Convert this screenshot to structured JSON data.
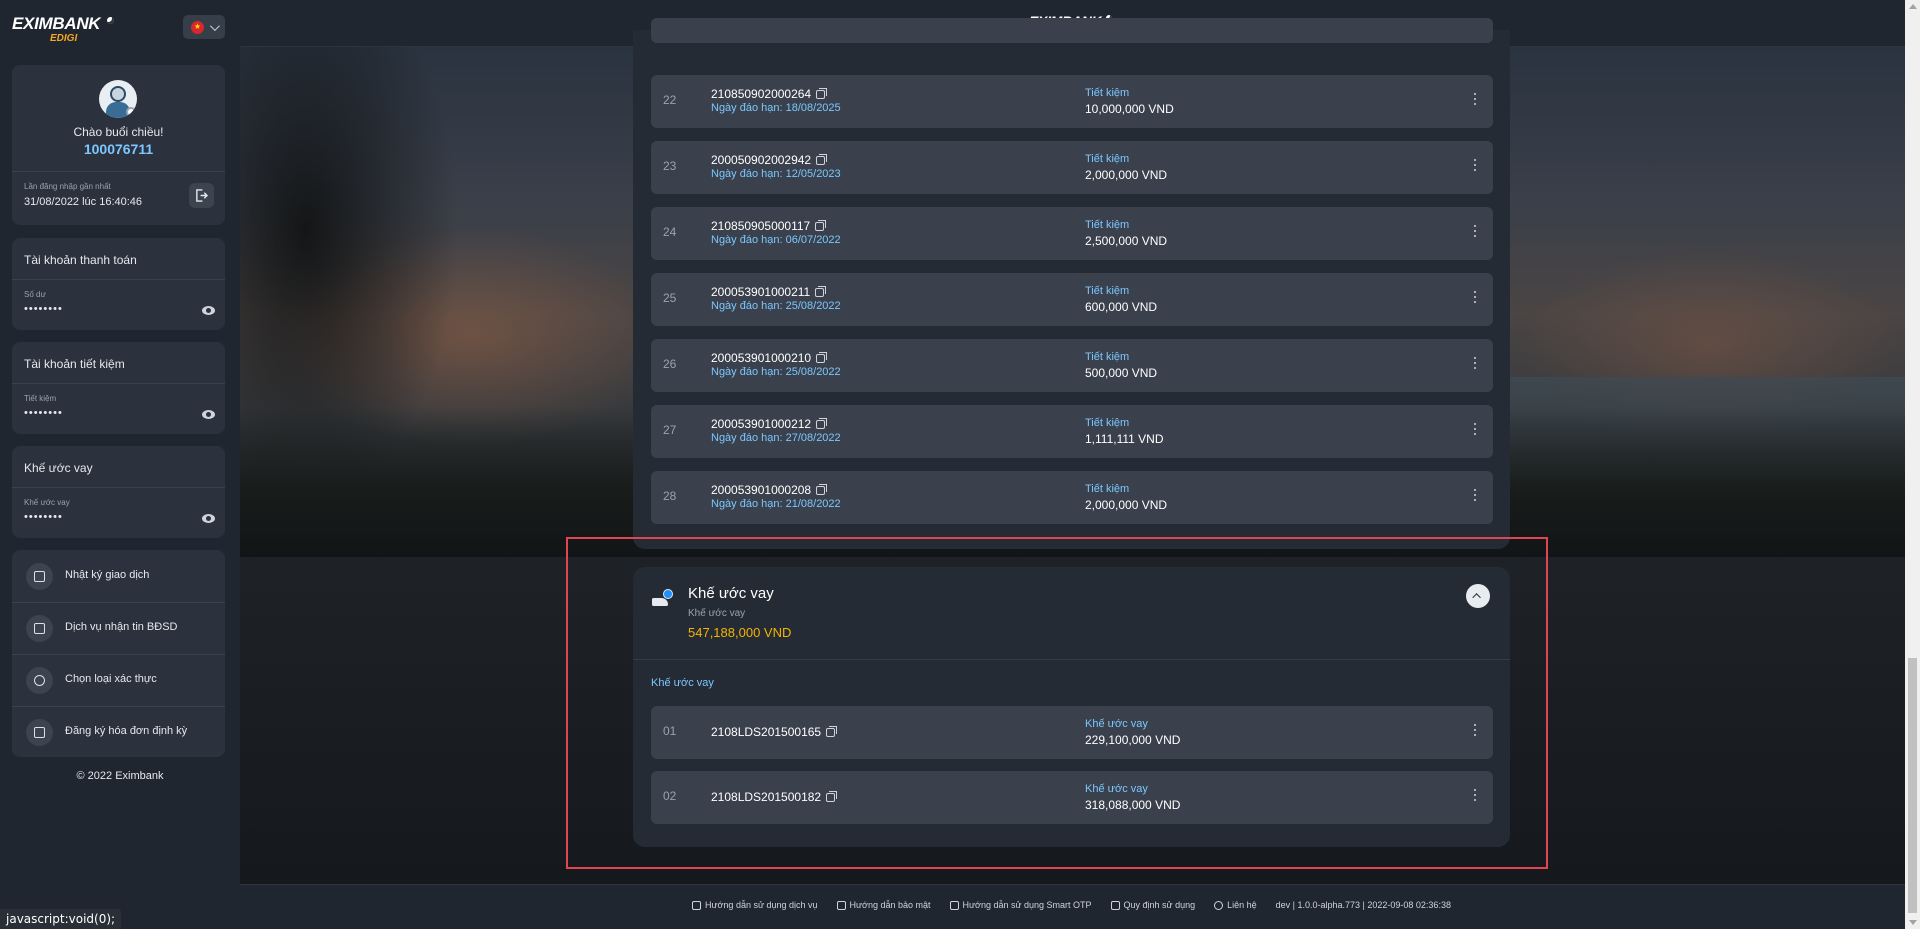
{
  "brand": {
    "name": "EXIMBANK",
    "sub": "EDIGI"
  },
  "language": {
    "flag": "★"
  },
  "profile": {
    "greeting": "Chào buổi chiều!",
    "account_number": "100076711",
    "last_login_label": "Lần đăng nhập gần nhất",
    "last_login_value": "31/08/2022 lúc 16:40:46"
  },
  "accounts": [
    {
      "title": "Tài khoản thanh toán",
      "label": "Số dư",
      "masked": "••••••••"
    },
    {
      "title": "Tài khoản tiết kiệm",
      "label": "Tiết kiệm",
      "masked": "••••••••"
    },
    {
      "title": "Khế ước vay",
      "label": "Khế ước vay",
      "masked": "••••••••"
    }
  ],
  "menu": [
    {
      "label": "Nhật ký giao dịch",
      "icon": "calendar-icon"
    },
    {
      "label": "Dịch vụ nhận tin BĐSD",
      "icon": "message-icon"
    },
    {
      "label": "Chọn loại xác thực",
      "icon": "shield-check-icon"
    },
    {
      "label": "Đăng ký hóa đơn định kỳ",
      "icon": "invoice-icon"
    }
  ],
  "copyright": "© 2022 Eximbank",
  "savings_rows": [
    {
      "index": "22",
      "number": "210850902000264",
      "due": "Ngày đáo hạn: 18/08/2025",
      "type": "Tiết kiệm",
      "amount": "10,000,000 VND"
    },
    {
      "index": "23",
      "number": "200050902002942",
      "due": "Ngày đáo hạn: 12/05/2023",
      "type": "Tiết kiệm",
      "amount": "2,000,000 VND"
    },
    {
      "index": "24",
      "number": "210850905000117",
      "due": "Ngày đáo hạn: 06/07/2022",
      "type": "Tiết kiệm",
      "amount": "2,500,000 VND"
    },
    {
      "index": "25",
      "number": "200053901000211",
      "due": "Ngày đáo hạn: 25/08/2022",
      "type": "Tiết kiệm",
      "amount": "600,000 VND"
    },
    {
      "index": "26",
      "number": "200053901000210",
      "due": "Ngày đáo hạn: 25/08/2022",
      "type": "Tiết kiệm",
      "amount": "500,000 VND"
    },
    {
      "index": "27",
      "number": "200053901000212",
      "due": "Ngày đáo hạn: 27/08/2022",
      "type": "Tiết kiệm",
      "amount": "1,111,111 VND"
    },
    {
      "index": "28",
      "number": "200053901000208",
      "due": "Ngày đáo hạn: 21/08/2022",
      "type": "Tiết kiệm",
      "amount": "2,000,000 VND"
    }
  ],
  "loan": {
    "title": "Khế ước vay",
    "subtitle": "Khế ước vay",
    "total": "547,188,000 VND",
    "section_label": "Khế ước vay",
    "rows": [
      {
        "index": "01",
        "number": "2108LDS201500165",
        "type": "Khế ước vay",
        "amount": "229,100,000 VND"
      },
      {
        "index": "02",
        "number": "2108LDS201500182",
        "type": "Khế ước vay",
        "amount": "318,088,000 VND"
      }
    ]
  },
  "footer": {
    "links": [
      "Hướng dẫn sử dụng dịch vụ",
      "Hướng dẫn bảo mật",
      "Hướng dẫn sử dụng Smart OTP",
      "Quy định sử dụng",
      "Liên hệ"
    ],
    "version": "dev | 1.0.0-alpha.773 | 2022-09-08 02:36:38"
  },
  "status_bar": "javascript:void(0);"
}
